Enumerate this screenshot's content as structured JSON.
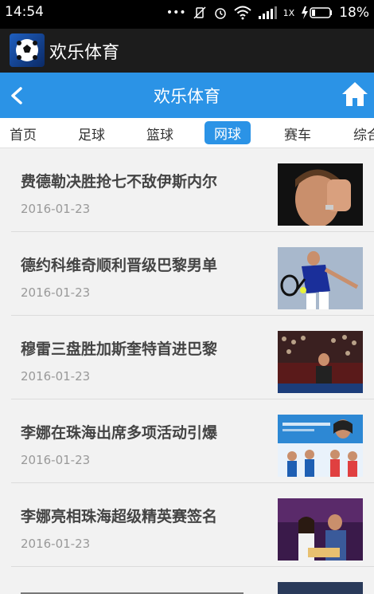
{
  "status": {
    "time": "14:54",
    "battery": "18%",
    "network": "1X"
  },
  "app": {
    "title": "欢乐体育"
  },
  "header": {
    "title": "欢乐体育"
  },
  "tabs": [
    {
      "label": "首页"
    },
    {
      "label": "足球"
    },
    {
      "label": "篮球"
    },
    {
      "label": "网球",
      "active": true
    },
    {
      "label": "赛车"
    },
    {
      "label": "综合"
    }
  ],
  "news": [
    {
      "title": "费德勒决胜抢七不敌伊斯内尔",
      "date": "2016-01-23"
    },
    {
      "title": "德约科维奇顺利晋级巴黎男单",
      "date": "2016-01-23"
    },
    {
      "title": "穆雷三盘胜加斯奎特首进巴黎",
      "date": "2016-01-23"
    },
    {
      "title": "李娜在珠海出席多项活动引爆",
      "date": "2016-01-23"
    },
    {
      "title": "李娜亮相珠海超级精英赛签名",
      "date": "2016-01-23"
    }
  ],
  "colors": {
    "accent": "#2b93e6",
    "app_bar": "#1c1c1c"
  }
}
